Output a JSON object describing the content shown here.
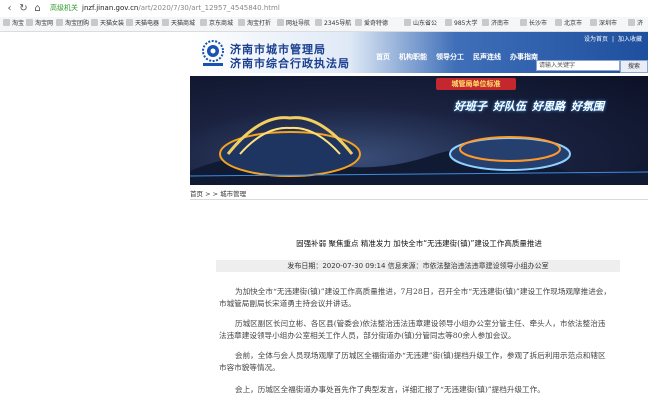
{
  "browser": {
    "security_label": "高级机关",
    "url_main": "jnzf.jinan.gov.cn",
    "url_path": "/art/2020/7/30/art_12957_4545840.html"
  },
  "bookmarks": [
    {
      "label": "淘宝"
    },
    {
      "label": "淘宝网"
    },
    {
      "label": "淘宝团购"
    },
    {
      "label": "天猫女装"
    },
    {
      "label": "天猫电器"
    },
    {
      "label": "天猫商城"
    },
    {
      "label": "京东商城"
    },
    {
      "label": "淘宝打折"
    },
    {
      "label": "网址导航"
    },
    {
      "label": "2345导航"
    },
    {
      "label": "爱奇特德"
    },
    {
      "label": "山东省公"
    },
    {
      "label": "985大学"
    },
    {
      "label": "济南市"
    },
    {
      "label": "长沙市"
    },
    {
      "label": "北京市"
    },
    {
      "label": "深圳市"
    },
    {
      "label": "济"
    }
  ],
  "header": {
    "title_line1": "济南市城市管理局",
    "title_line2": "济南市综合行政执法局",
    "top_links": [
      "设为首页",
      "加入收藏"
    ],
    "nav": [
      "首页",
      "机构职能",
      "领导分工",
      "民声连线",
      "办事指南"
    ],
    "search_placeholder": "请输入关键字",
    "search_button": "搜索"
  },
  "banner": {
    "ribbon": "城管局单位标准",
    "slogans": [
      "好班子",
      "好队伍",
      "好思路",
      "好氛围"
    ]
  },
  "breadcrumb": "首页 > > 城市管理",
  "article": {
    "title": "固强补弱  聚焦重点    精准发力 加快全市“无违建街(镇)”建设工作高质量推进",
    "meta": "发布日期：2020-07-30 09:14    信息来源：市依法整治违法违章建设领导小组办公室",
    "paragraphs": [
      "为加快全市“无违建街(镇)”建设工作高质量推进，7月28日，召开全市“无违建街(镇)”建设工作现场观摩推进会，市城管局副局长宋道勇主持会议并讲话。",
      "历城区副区长闫立彬、各区县(管委会)依法整治违法违章建设领导小组办公室分管主任、牵头人，市依法整治违法违章建设领导小组办公室相关工作人员，部分街道办(镇)分管同志等80余人参加会议。",
      "会前，全体与会人员现场观摩了历城区全福街道办“无违建”街(镇)提档升级工作，参观了拆后利用示范点和辖区市容市貌等情况。",
      "会上，历城区全福街道办事处首先作了典型发言，详细汇报了“无违建街(镇)”提档升级工作。"
    ]
  }
}
